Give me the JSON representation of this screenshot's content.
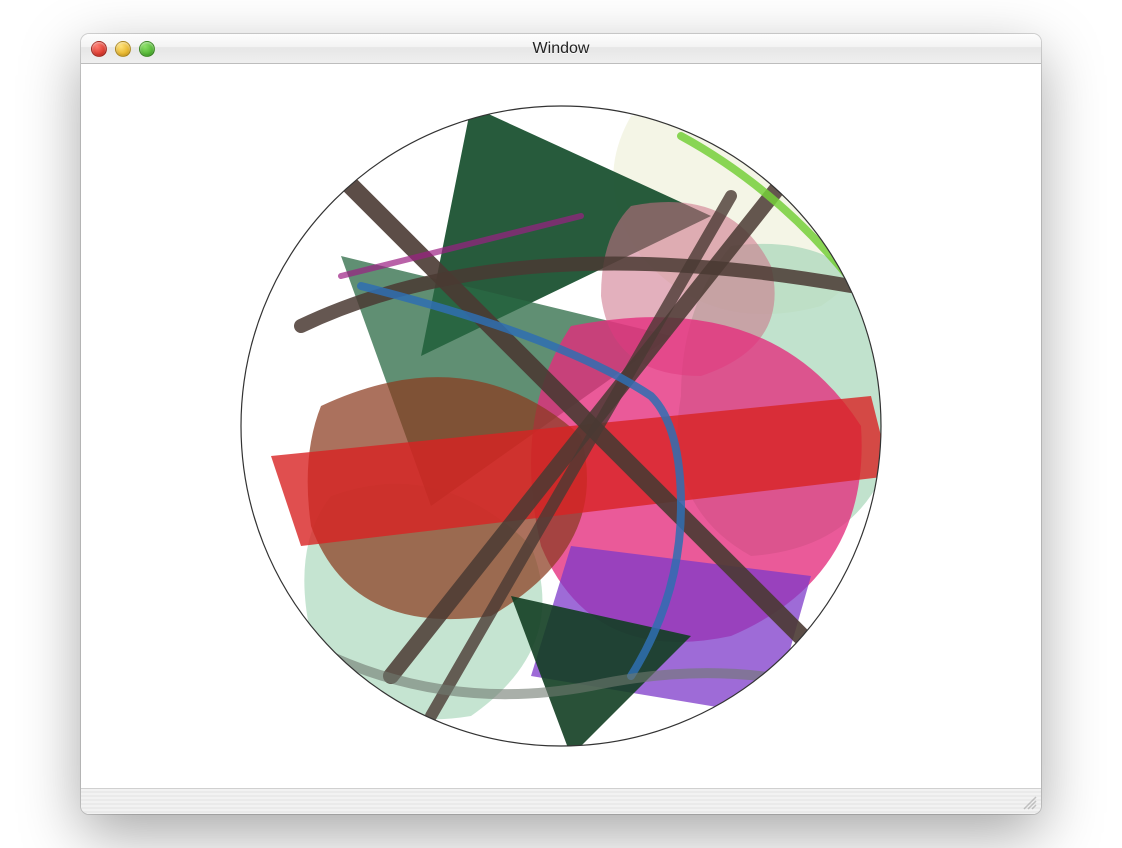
{
  "window": {
    "title": "Window",
    "traffic_lights": {
      "close": "close-icon",
      "minimize": "minimize-icon",
      "zoom": "zoom-icon"
    }
  },
  "canvas": {
    "clip_shape": "circle",
    "clip_radius": 320,
    "background": "#ffffff",
    "shapes": [
      {
        "type": "blob",
        "fill": "#f2f3e2",
        "opacity": 0.85
      },
      {
        "type": "blob",
        "fill": "#a6d6b8",
        "opacity": 0.7
      },
      {
        "type": "triangle",
        "fill": "#1b5232",
        "opacity": 0.95
      },
      {
        "type": "triangle",
        "fill": "#2b6a44",
        "opacity": 0.75
      },
      {
        "type": "stroke",
        "color": "#4a3a33",
        "width": 18,
        "opacity": 0.9
      },
      {
        "type": "stroke",
        "color": "#4a3a33",
        "width": 14,
        "opacity": 0.85
      },
      {
        "type": "blob",
        "fill": "#e42c7c",
        "opacity": 0.78
      },
      {
        "type": "blob",
        "fill": "#7e3ac9",
        "opacity": 0.75
      },
      {
        "type": "quad",
        "fill": "#d82323",
        "opacity": 0.8
      },
      {
        "type": "blob",
        "fill": "#8b3a1e",
        "opacity": 0.72
      },
      {
        "type": "stroke",
        "color": "#2f6fb2",
        "width": 8,
        "opacity": 0.85
      },
      {
        "type": "stroke",
        "color": "#6f7a70",
        "width": 10,
        "opacity": 0.6
      },
      {
        "type": "stroke",
        "color": "#76cf3a",
        "width": 8,
        "opacity": 0.85
      },
      {
        "type": "stroke",
        "color": "#9b1f83",
        "width": 6,
        "opacity": 0.7
      },
      {
        "type": "blob",
        "fill": "#cc6f87",
        "opacity": 0.55
      },
      {
        "type": "triangle",
        "fill": "#123e22",
        "opacity": 0.9
      }
    ]
  }
}
